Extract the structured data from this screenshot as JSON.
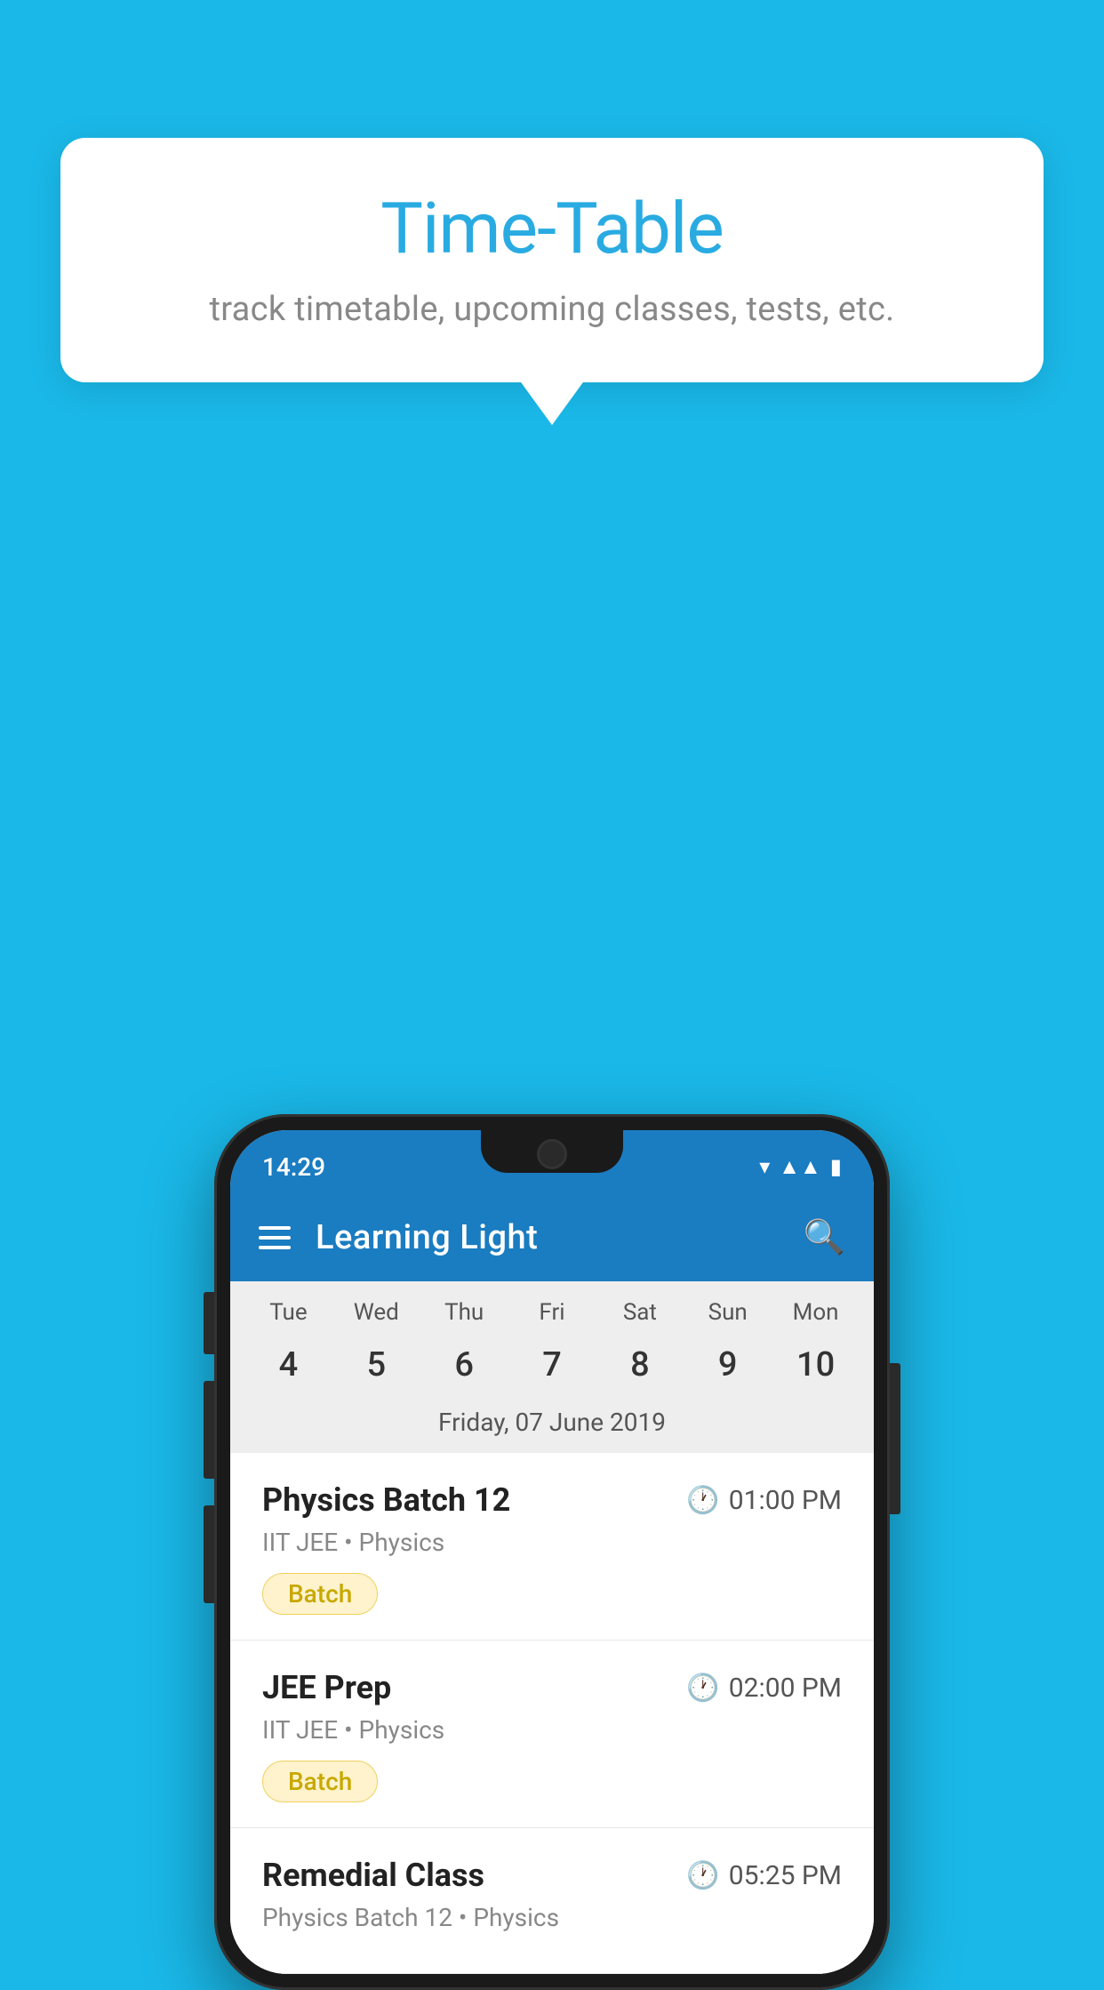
{
  "background": {
    "color": "#1ab8e8"
  },
  "tooltip": {
    "title": "Time-Table",
    "subtitle": "track timetable, upcoming classes, tests, etc."
  },
  "phone": {
    "status_bar": {
      "time": "14:29"
    },
    "app_bar": {
      "title": "Learning Light",
      "menu_icon": "hamburger-icon",
      "search_icon": "search-icon"
    },
    "calendar": {
      "days": [
        {
          "label": "Tue",
          "num": "4"
        },
        {
          "label": "Wed",
          "num": "5"
        },
        {
          "label": "Thu",
          "num": "6",
          "state": "today"
        },
        {
          "label": "Fri",
          "num": "7",
          "state": "selected"
        },
        {
          "label": "Sat",
          "num": "8"
        },
        {
          "label": "Sun",
          "num": "9"
        },
        {
          "label": "Mon",
          "num": "10"
        }
      ],
      "selected_date": "Friday, 07 June 2019"
    },
    "schedule": [
      {
        "title": "Physics Batch 12",
        "time": "01:00 PM",
        "subtitle": "IIT JEE • Physics",
        "tag": "Batch"
      },
      {
        "title": "JEE Prep",
        "time": "02:00 PM",
        "subtitle": "IIT JEE • Physics",
        "tag": "Batch"
      },
      {
        "title": "Remedial Class",
        "time": "05:25 PM",
        "subtitle": "Physics Batch 12 • Physics",
        "tag": null
      }
    ]
  }
}
